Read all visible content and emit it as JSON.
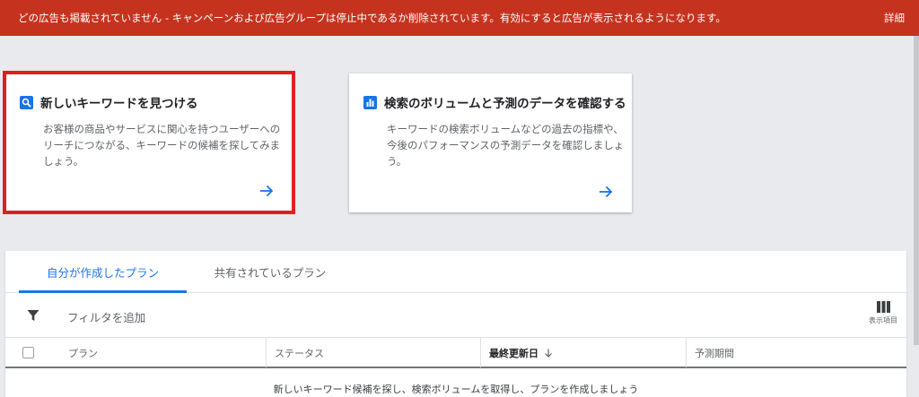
{
  "banner": {
    "message": "どの広告も掲載されていません - キャンペーンおよび広告グループは停止中であるか削除されています。有効にすると広告が表示されるようになります。",
    "details_label": "詳細",
    "color": "#c5331f"
  },
  "cards": [
    {
      "icon": "search-icon",
      "title": "新しいキーワードを見つける",
      "description": "お客様の商品やサービスに関心を持つユーザーへのリーチにつながる、キーワードの候補を探してみましょう。",
      "highlighted": true
    },
    {
      "icon": "bar-chart-icon",
      "title": "検索のボリュームと予測のデータを確認する",
      "description": "キーワードの検索ボリュームなどの過去の指標や、今後のパフォーマンスの予測データを確認しましょう。",
      "highlighted": false
    }
  ],
  "tabs": [
    {
      "label": "自分が作成したプラン",
      "active": true
    },
    {
      "label": "共有されているプラン",
      "active": false
    }
  ],
  "filter": {
    "label": "フィルタを追加",
    "icon": "filter-icon"
  },
  "columns_button": {
    "label": "表示項目",
    "icon": "columns-icon"
  },
  "table": {
    "headers": [
      "プラン",
      "ステータス",
      "最終更新日",
      "予測期間"
    ],
    "sorted_column": "最終更新日",
    "sort_direction": "descending",
    "empty_message": "新しいキーワード候補を探し、検索ボリュームを取得し、プランを作成しましょう"
  },
  "colors": {
    "accent": "#1a73e8",
    "highlight_border": "#e02020"
  }
}
